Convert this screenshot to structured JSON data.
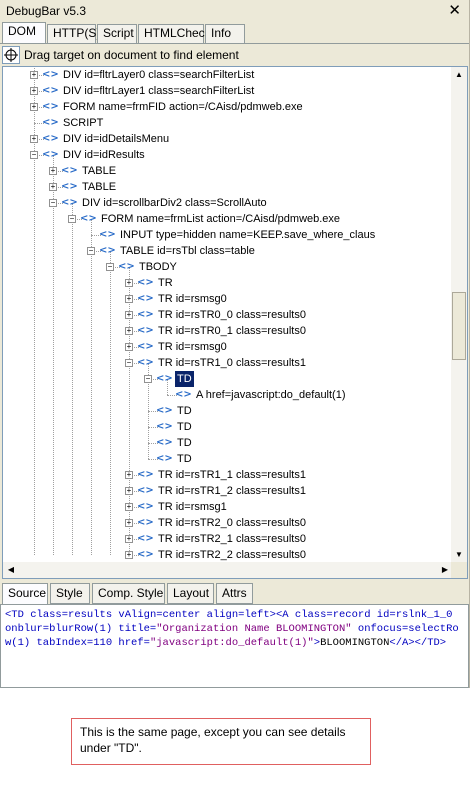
{
  "window": {
    "title": "DebugBar v5.3",
    "close": "✕"
  },
  "top_tabs": [
    "DOM",
    "HTTP(S)",
    "Script",
    "HTMLCheck",
    "Info"
  ],
  "drag_text": "Drag target on document to find element",
  "tree": [
    {
      "label": "DIV id=fltrLayer0 class=searchFilterList",
      "exp": "+"
    },
    {
      "label": "DIV id=fltrLayer1 class=searchFilterList",
      "exp": "+"
    },
    {
      "label": "FORM name=frmFID action=/CAisd/pdmweb.exe",
      "exp": "+"
    },
    {
      "label": "SCRIPT",
      "exp": ""
    },
    {
      "label": "DIV id=idDetailsMenu",
      "exp": "+"
    },
    {
      "label": "DIV id=idResults",
      "exp": "−"
    },
    {
      "label": "TABLE",
      "exp": "+"
    },
    {
      "label": "TABLE",
      "exp": "+"
    },
    {
      "label": "DIV id=scrollbarDiv2 class=ScrollAuto",
      "exp": "−"
    },
    {
      "label": "FORM name=frmList action=/CAisd/pdmweb.exe",
      "exp": "−"
    },
    {
      "label": "INPUT type=hidden name=KEEP.save_where_claus",
      "exp": ""
    },
    {
      "label": "TABLE id=rsTbl class=table",
      "exp": "−"
    },
    {
      "label": "TBODY",
      "exp": "−"
    },
    {
      "label": "TR",
      "exp": "+"
    },
    {
      "label": "TR id=rsmsg0",
      "exp": "+"
    },
    {
      "label": "TR id=rsTR0_0 class=results0",
      "exp": "+"
    },
    {
      "label": "TR id=rsTR0_1 class=results0",
      "exp": "+"
    },
    {
      "label": "TR id=rsmsg0",
      "exp": "+"
    },
    {
      "label": "TR id=rsTR1_0 class=results1",
      "exp": "−"
    },
    {
      "label": "TD",
      "exp": "−"
    },
    {
      "label": "A href=javascript:do_default(1)",
      "exp": ""
    },
    {
      "label": "TD",
      "exp": ""
    },
    {
      "label": "TD",
      "exp": ""
    },
    {
      "label": "TD",
      "exp": ""
    },
    {
      "label": "TD",
      "exp": ""
    },
    {
      "label": "TR id=rsTR1_1 class=results1",
      "exp": "+"
    },
    {
      "label": "TR id=rsTR1_2 class=results1",
      "exp": "+"
    },
    {
      "label": "TR id=rsmsg1",
      "exp": "+"
    },
    {
      "label": "TR id=rsTR2_0 class=results0",
      "exp": "+"
    },
    {
      "label": "TR id=rsTR2_1 class=results0",
      "exp": "+"
    },
    {
      "label": "TR id=rsTR2_2 class=results0",
      "exp": "+"
    }
  ],
  "selected_node": "TD",
  "bottom_tabs": [
    "Source",
    "Style",
    "Comp. Style",
    "Layout",
    "Attrs"
  ],
  "source": {
    "tag_open": "<TD",
    "td_attrs": "class=results vAlign=center align=left",
    "a_open": "><A",
    "a_attrs_1": "class=record id=rslnk_1_0 onblur=blurRow(1) title=",
    "title_val": "\"Organization Name BLOOMINGTON\"",
    "a_attrs_2": "onfocus=selectRow(1) tabIndex=110 href=",
    "href_val": "\"javascript:do_default(1)\"",
    "gt": ">",
    "text": "BLOOMINGTON",
    "close": "</A></TD>"
  },
  "note": "This is the same page, except you can see details under \"TD\".",
  "colors": {
    "selection": "#0a246a",
    "tag": "#0000c0",
    "value": "#800080",
    "note_border": "#e06060"
  }
}
